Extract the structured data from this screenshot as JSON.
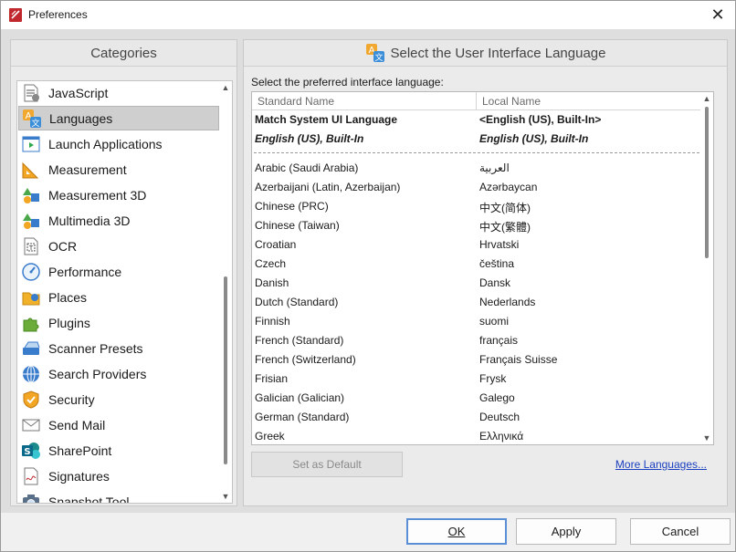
{
  "window": {
    "title": "Preferences",
    "close_symbol": "✕"
  },
  "categories": {
    "header": "Categories",
    "items": [
      {
        "label": "JavaScript",
        "icon": "javascript-icon",
        "selected": false
      },
      {
        "label": "Languages",
        "icon": "languages-icon",
        "selected": true
      },
      {
        "label": "Launch Applications",
        "icon": "launch-applications-icon",
        "selected": false
      },
      {
        "label": "Measurement",
        "icon": "measurement-icon",
        "selected": false
      },
      {
        "label": "Measurement 3D",
        "icon": "measurement-3d-icon",
        "selected": false
      },
      {
        "label": "Multimedia 3D",
        "icon": "multimedia-3d-icon",
        "selected": false
      },
      {
        "label": "OCR",
        "icon": "ocr-icon",
        "selected": false
      },
      {
        "label": "Performance",
        "icon": "performance-icon",
        "selected": false
      },
      {
        "label": "Places",
        "icon": "places-icon",
        "selected": false
      },
      {
        "label": "Plugins",
        "icon": "plugins-icon",
        "selected": false
      },
      {
        "label": "Scanner Presets",
        "icon": "scanner-presets-icon",
        "selected": false
      },
      {
        "label": "Search Providers",
        "icon": "search-providers-icon",
        "selected": false
      },
      {
        "label": "Security",
        "icon": "security-icon",
        "selected": false
      },
      {
        "label": "Send Mail",
        "icon": "send-mail-icon",
        "selected": false
      },
      {
        "label": "SharePoint",
        "icon": "sharepoint-icon",
        "selected": false
      },
      {
        "label": "Signatures",
        "icon": "signatures-icon",
        "selected": false
      },
      {
        "label": "Snapshot Tool",
        "icon": "snapshot-tool-icon",
        "selected": false
      }
    ]
  },
  "language_panel": {
    "header": "Select the User Interface Language",
    "instruction": "Select the preferred interface language:",
    "columns": {
      "standard": "Standard Name",
      "local": "Local Name"
    },
    "top_rows": [
      {
        "standard": "Match System UI Language",
        "local": "<English (US), Built-In>",
        "style": "bold"
      },
      {
        "standard": "English (US), Built-In",
        "local": "English (US), Built-In",
        "style": "bold-italic"
      }
    ],
    "rows": [
      {
        "standard": "Arabic (Saudi Arabia)",
        "local": "العربية"
      },
      {
        "standard": "Azerbaijani (Latin, Azerbaijan)",
        "local": "Azərbaycan"
      },
      {
        "standard": "Chinese (PRC)",
        "local": "中文(简体)"
      },
      {
        "standard": "Chinese (Taiwan)",
        "local": "中文(繁體)"
      },
      {
        "standard": "Croatian",
        "local": "Hrvatski"
      },
      {
        "standard": "Czech",
        "local": "čeština"
      },
      {
        "standard": "Danish",
        "local": "Dansk"
      },
      {
        "standard": "Dutch (Standard)",
        "local": "Nederlands"
      },
      {
        "standard": "Finnish",
        "local": "suomi"
      },
      {
        "standard": "French (Standard)",
        "local": "français"
      },
      {
        "standard": "French (Switzerland)",
        "local": "Français Suisse"
      },
      {
        "standard": "Frisian",
        "local": "Frysk"
      },
      {
        "standard": "Galician (Galician)",
        "local": "Galego"
      },
      {
        "standard": "German (Standard)",
        "local": "Deutsch"
      },
      {
        "standard": "Greek",
        "local": "Ελληνικά"
      }
    ],
    "set_default_label": "Set as Default",
    "more_languages_label": "More Languages..."
  },
  "footer": {
    "ok_label": "OK",
    "apply_label": "Apply",
    "cancel_label": "Cancel"
  }
}
